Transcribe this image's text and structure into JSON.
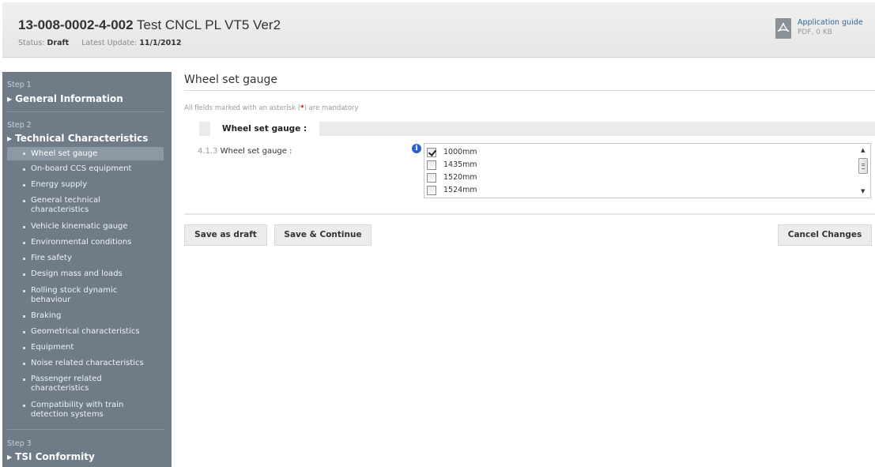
{
  "header": {
    "doc_code": "13-008-0002-4-002",
    "doc_name": "Test CNCL PL VT5 Ver2",
    "status_label": "Status:",
    "status_value": "Draft",
    "update_label": "Latest Update:",
    "update_value": "11/1/2012",
    "guide_label": "Application guide",
    "guide_sub": "PDF, 0 KB",
    "guide_icon": "pdf-icon"
  },
  "sidebar": {
    "step1": {
      "label": "Step 1",
      "title": "General Information"
    },
    "step2": {
      "label": "Step 2",
      "title": "Technical Characteristics",
      "items": [
        {
          "label": "Wheel set gauge",
          "active": true
        },
        {
          "label": "On-board CCS equipment"
        },
        {
          "label": "Energy supply"
        },
        {
          "label": "General technical characteristics"
        },
        {
          "label": "Vehicle kinematic gauge"
        },
        {
          "label": "Environmental conditions"
        },
        {
          "label": "Fire safety"
        },
        {
          "label": "Design mass and loads"
        },
        {
          "label": "Rolling stock dynamic behaviour"
        },
        {
          "label": "Braking"
        },
        {
          "label": "Geometrical characteristics"
        },
        {
          "label": "Equipment"
        },
        {
          "label": "Noise related characteristics"
        },
        {
          "label": "Passenger related characteristics"
        },
        {
          "label": "Compatibility with train detection systems"
        }
      ]
    },
    "step3": {
      "label": "Step 3",
      "title": "TSI Conformity"
    }
  },
  "main": {
    "title": "Wheel set gauge",
    "mandatory_prefix": "All fields marked with an asterisk (",
    "mandatory_asterisk": "*",
    "mandatory_suffix": ") are mandatory",
    "section_tab": "Wheel set gauge :",
    "field_number": "4.1.3",
    "field_label": "Wheel set gauge :",
    "info_icon_glyph": "i",
    "options": [
      {
        "label": "1000mm",
        "checked": true
      },
      {
        "label": "1435mm",
        "checked": false
      },
      {
        "label": "1520mm",
        "checked": false
      },
      {
        "label": "1524mm",
        "checked": false
      }
    ]
  },
  "buttons": {
    "save_draft": "Save as draft",
    "save_continue": "Save & Continue",
    "cancel": "Cancel Changes"
  }
}
